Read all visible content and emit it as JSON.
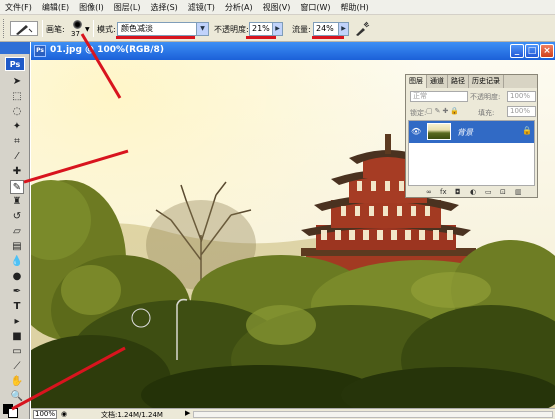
{
  "menubar": {
    "items": [
      "文件(F)",
      "编辑(E)",
      "图像(I)",
      "图层(L)",
      "选择(S)",
      "滤镜(T)",
      "分析(A)",
      "视图(V)",
      "窗口(W)",
      "帮助(H)"
    ]
  },
  "options": {
    "brush_label": "画笔:",
    "brush_size": "37",
    "mode_label": "模式:",
    "mode_value": "颜色减淡",
    "opacity_label": "不透明度:",
    "opacity_value": "21%",
    "flow_label": "流量:",
    "flow_value": "24%"
  },
  "toolbox": {
    "logo": "Ps"
  },
  "document": {
    "title": "01.jpg @ 100%(RGB/8)",
    "zoom": "100%",
    "doc_info": "文档:1.24M/1.24M"
  },
  "layers_panel": {
    "tabs": [
      "图层",
      "通道",
      "路径",
      "历史记录"
    ],
    "blend_mode": "正常",
    "opacity_label": "不透明度:",
    "opacity_value": "100%",
    "lock_label": "锁定:",
    "fill_label": "填充:",
    "fill_value": "100%",
    "layer_name": "背景"
  },
  "annotation_color": "#d8141e"
}
